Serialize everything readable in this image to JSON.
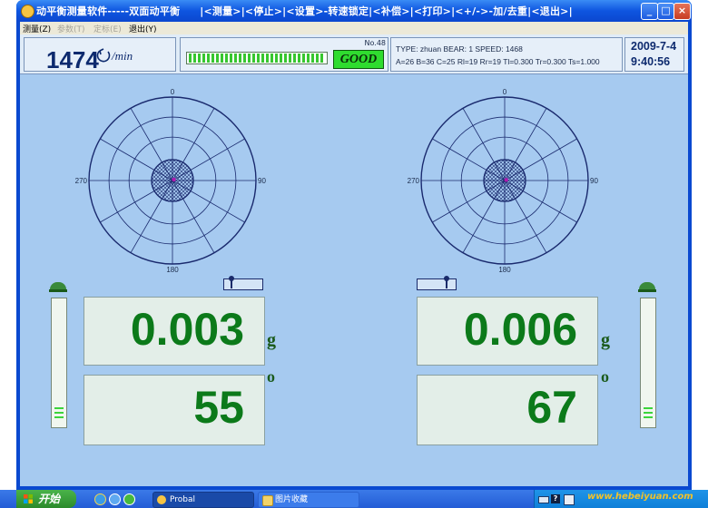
{
  "window": {
    "title": "动平衡测量软件-----双面动平衡",
    "title_menu": "|<测量>|<停止>|<设置>-转速锁定|<补偿>|<打印>|<+/->-加/去重|<退出>|",
    "controls": {
      "minimize": "_",
      "maximize": "□",
      "close": "×"
    }
  },
  "menubar": {
    "items": [
      {
        "label": "测量(Z)",
        "enabled": true
      },
      {
        "label": "参数(T)",
        "enabled": false
      },
      {
        "label": "定标(E)",
        "enabled": false
      },
      {
        "label": "退出(Y)",
        "enabled": true
      }
    ]
  },
  "status": {
    "rpm": "1474",
    "rpm_unit": "/min",
    "rpm_icon": "rotation-arrow-icon",
    "sample_no": "No.48",
    "quality": "GOOD",
    "quality_color": "#2fdc2f",
    "signal_level": 1.0,
    "info_line1": "TYPE: zhuan     BEAR: 1     SPEED: 1468",
    "info_line2": "A=26 B=36 C=25 Rl=19 Rr=19 Tl=0.300 Tr=0.300 Ts=1.000",
    "date": "2009-7-4",
    "time": "9:40:56"
  },
  "polar_plots": [
    {
      "side": "left",
      "labels": {
        "top": "0",
        "right": "90",
        "bottom": "180",
        "left": "270"
      },
      "angle_deg": 55,
      "radius_fraction": 0.02,
      "tolerance_fraction": 0.25
    },
    {
      "side": "right",
      "labels": {
        "top": "0",
        "right": "90",
        "bottom": "180",
        "left": "270"
      },
      "angle_deg": 67,
      "radius_fraction": 0.02,
      "tolerance_fraction": 0.25
    }
  ],
  "readouts": {
    "left": {
      "amount": "0.003",
      "amount_unit": "g",
      "angle": "55",
      "angle_unit": "o"
    },
    "right": {
      "amount": "0.006",
      "amount_unit": "g",
      "angle": "67",
      "angle_unit": "o"
    }
  },
  "gauges": {
    "left_level": 0.08,
    "right_level": 0.08
  },
  "sliders": {
    "left_position": 0.2,
    "right_position": 0.8
  },
  "colors": {
    "plot_line": "#1a2a6e",
    "readout_text": "#0c7a1a",
    "client_bg": "#a6caf0"
  },
  "taskbar": {
    "start_label": "开始",
    "tasks": [
      {
        "label": "Probal",
        "active": true
      },
      {
        "label": "图片收藏",
        "active": false
      }
    ],
    "watermark": "www.hebeiyuan.com"
  }
}
